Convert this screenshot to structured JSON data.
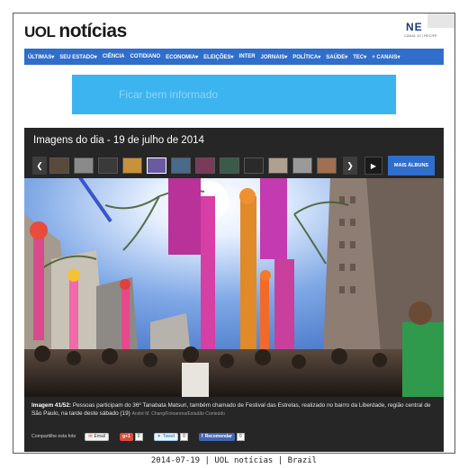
{
  "header": {
    "logo_uol": "UOL",
    "logo_noticias": "notícias",
    "partner_logo": "NE",
    "partner_sub": "CANAL 10 | RECIFE"
  },
  "nav": {
    "items": [
      "ÚLTIMAS▾",
      "SEU ESTADO▾",
      "CIÊNCIA",
      "COTIDIANO",
      "ECONOMIA▾",
      "ELEIÇÕES▾",
      "INTER",
      "JORNAIS▾",
      "POLÍTICA▾",
      "SAÚDE▾",
      "TEC▾",
      "+ CANAIS▾"
    ]
  },
  "banner": {
    "text": "Ficar bem informado"
  },
  "gallery": {
    "title": "Imagens do dia - 19 de julho de 2014",
    "prev_icon": "chevron-left-icon",
    "next_icon": "chevron-right-icon",
    "play_icon": "play-icon",
    "more_label": "MAIS ÁLBUNS",
    "thumb_colors": [
      "#5a4a3a",
      "#8a8a8a",
      "#3a3a3a",
      "#c7923a",
      "#6a5aa0",
      "#4a6a8a",
      "#7a3a5a",
      "#3a5a4a",
      "#2a2a2a",
      "#b0a090",
      "#9a9a9a",
      "#a07050"
    ],
    "active_thumb": 4
  },
  "caption": {
    "prefix": "Imagem 41/52:",
    "text": "Pessoas participam do 36º Tanabata Matsuri, também chamado de Festival das Estrelas, realizado no bairro da Liberdade, região central de São Paulo, na tarde deste sábado (19)",
    "credit": "André M. Chang/Fotoarena/Estadão Conteúdo"
  },
  "share": {
    "label": "Compartilhe esta foto",
    "email": "Email",
    "gplus": "g+1",
    "gplus_count": "0",
    "tweet": "Tweet",
    "tweet_count": "0",
    "facebook": "Recomendar",
    "facebook_count": "0"
  },
  "footer": {
    "text": "2014-07-19 | UOL notícias | Brazil"
  },
  "colors": {
    "nav_blue": "#2f6ecb",
    "banner_blue": "#3cb4ef",
    "gallery_bg": "#262626"
  }
}
